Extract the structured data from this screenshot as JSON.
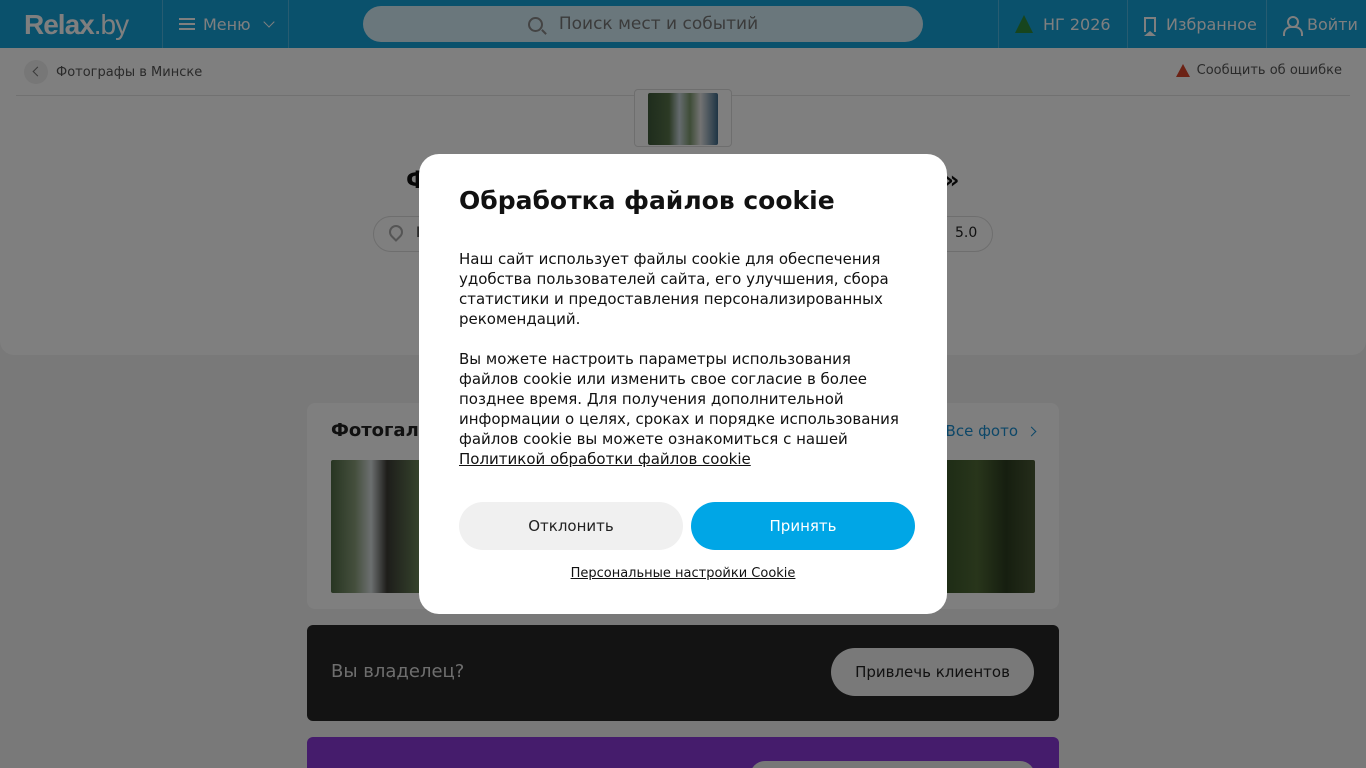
{
  "header": {
    "logo_main": "Relax",
    "logo_domain": ".by",
    "menu_label": "Меню",
    "search_placeholder": "Поиск мест и событий",
    "ng_label": "НГ 2026",
    "favorites_label": "Избранное",
    "login_label": "Войти"
  },
  "page": {
    "breadcrumb": "Фотографы в Минске",
    "report_label": "Сообщить об ошибке",
    "title_left_fragment": "Ф",
    "title_right_fragment": "»",
    "address_fragment": "I",
    "rating": "5.0"
  },
  "gallery": {
    "title": "Фотогалерея",
    "all_label": "Все фото"
  },
  "owner": {
    "text": "Вы владелец?",
    "button_label": "Привлечь клиентов"
  },
  "cookie_modal": {
    "title": "Обработка файлов cookie",
    "paragraph1": "Наш сайт использует файлы cookie для обеспечения удобства пользователей сайта, его улучшения, сбора статистики и предоставления персонализированных рекомендаций.",
    "paragraph2": "Вы можете настроить параметры использования файлов cookie или изменить свое согласие в более позднее время. Для получения дополнительной информации о целях, сроках и порядке использования файлов cookie вы можете ознакомиться с нашей",
    "policy_link": "Политикой обработки файлов cookie",
    "decline_label": "Отклонить",
    "accept_label": "Принять",
    "personal_settings_label": "Персональные настройки Cookie"
  },
  "colors": {
    "header_bg": "#14a2d9",
    "accept_bg": "#00a6e6",
    "owner_bg": "#262626",
    "promo_bg": "#8a38d8"
  }
}
